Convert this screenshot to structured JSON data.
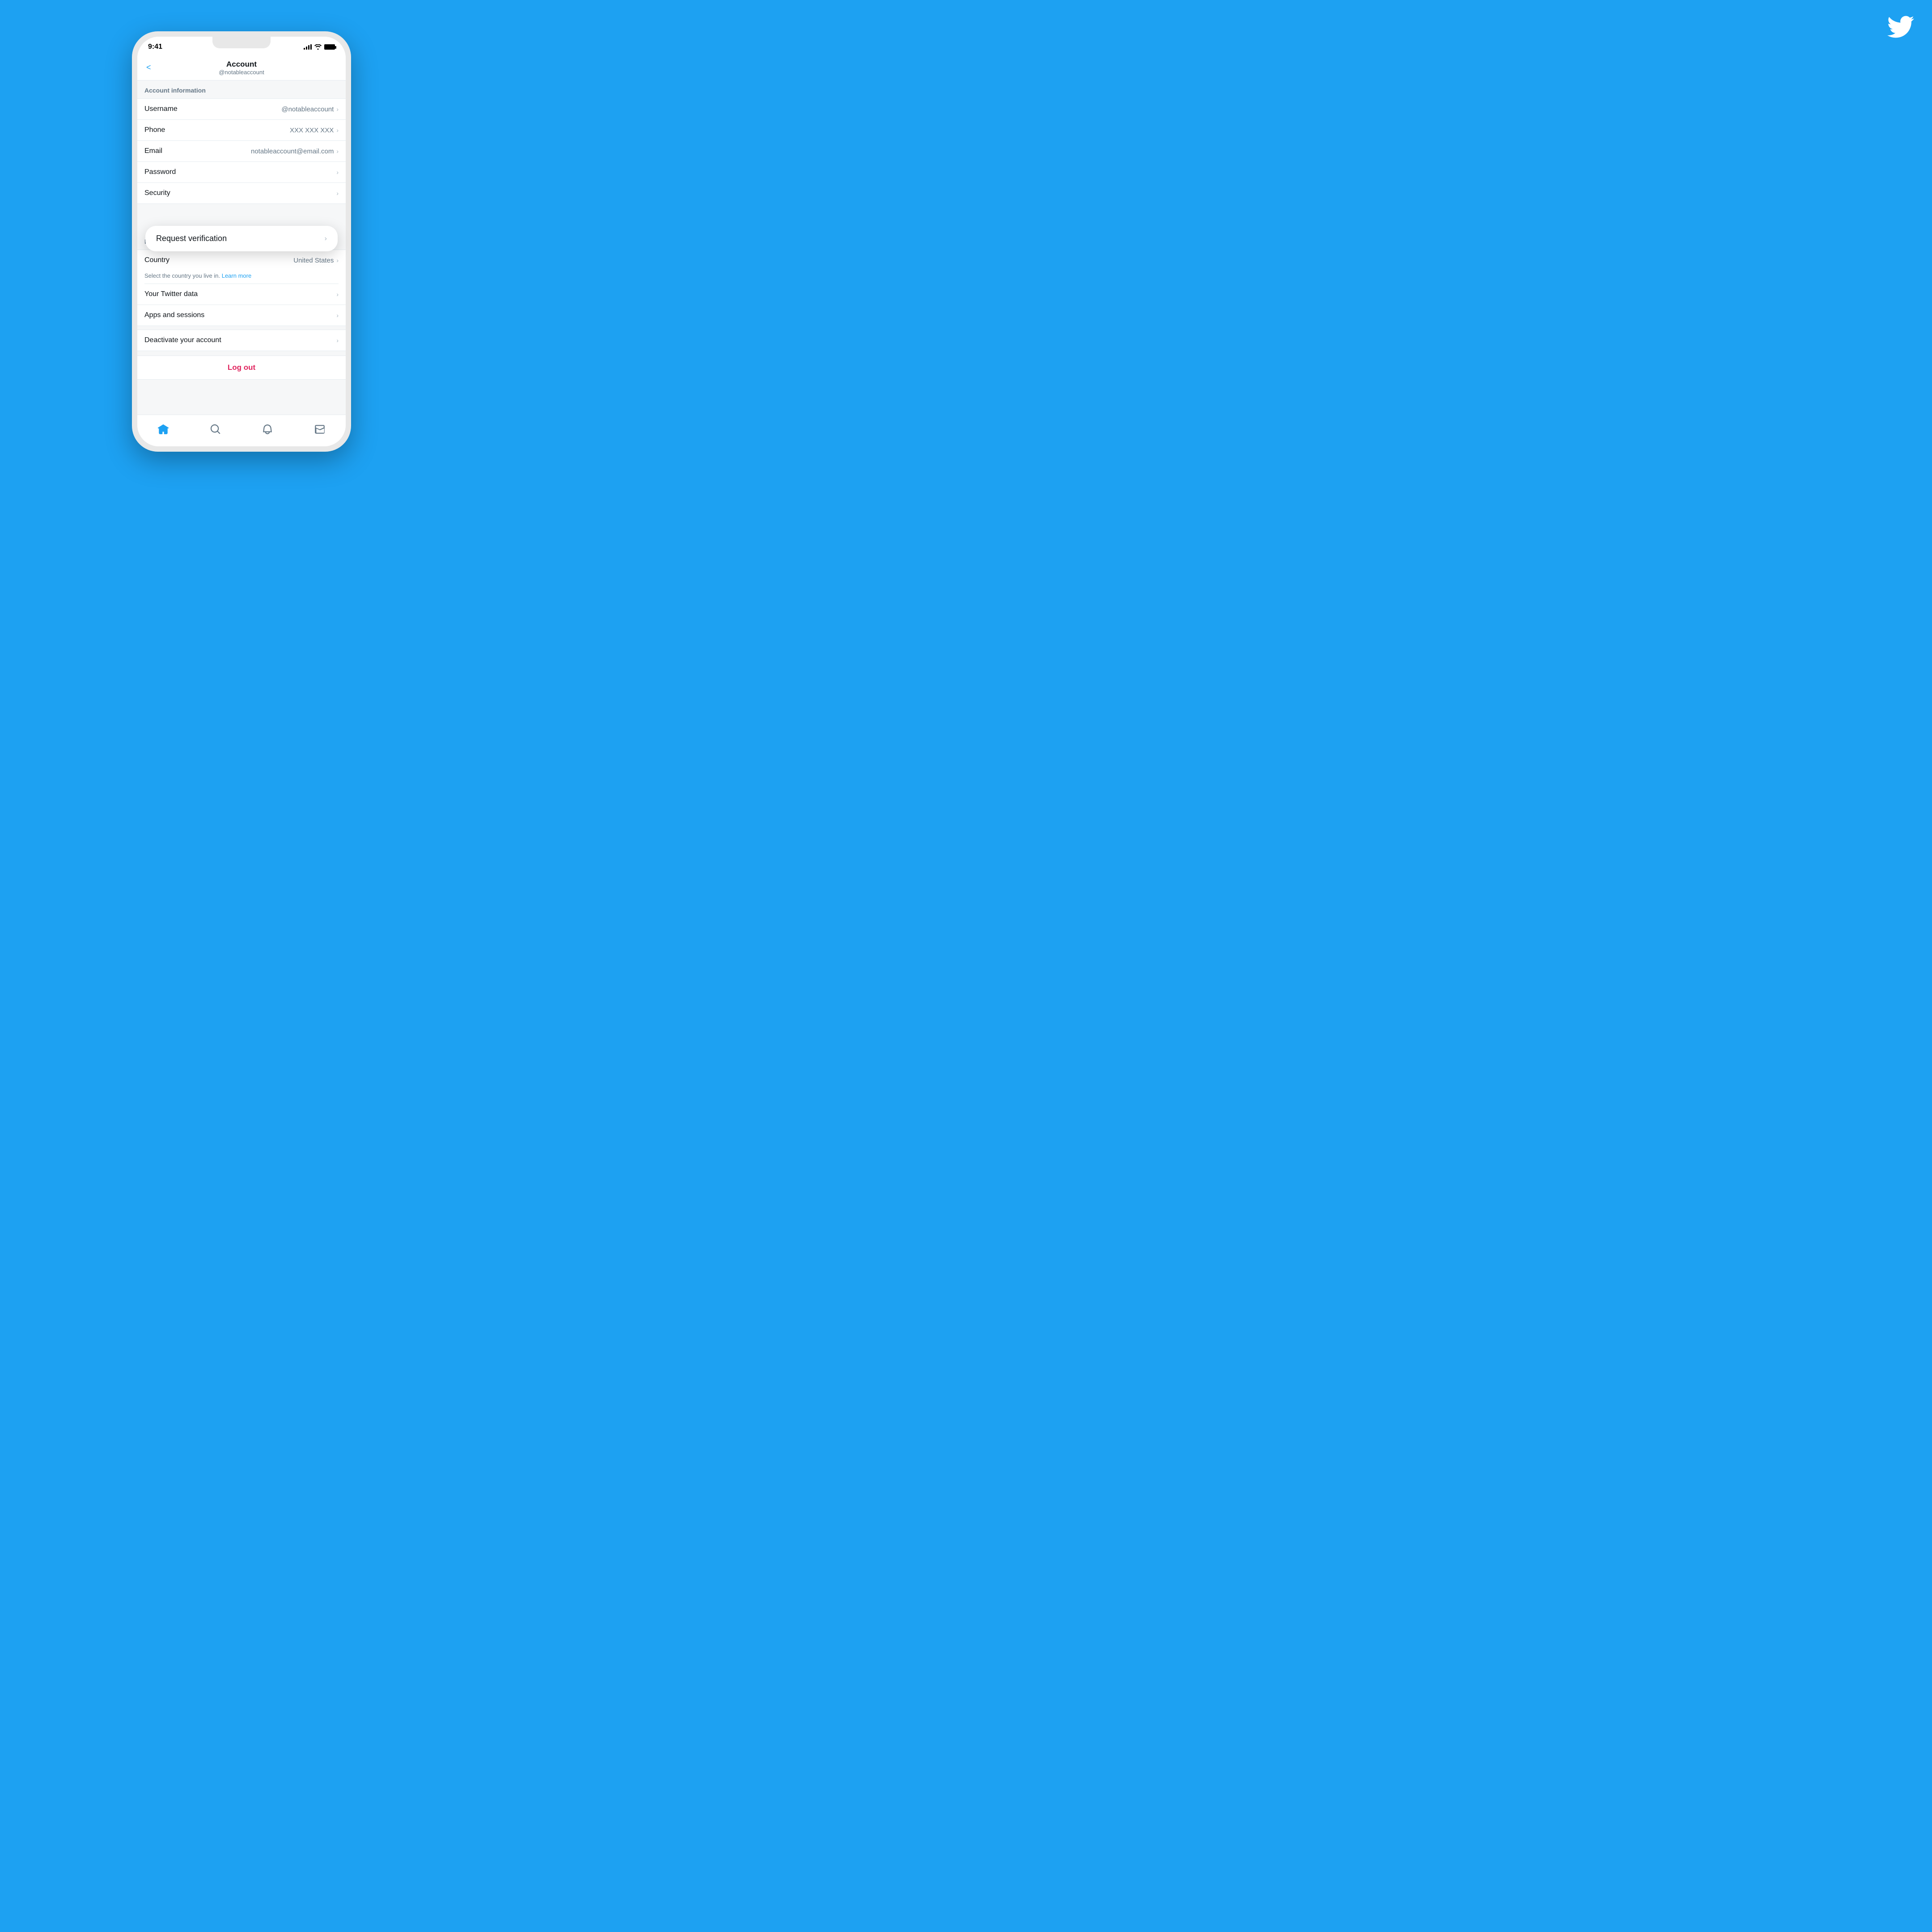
{
  "background_color": "#1DA1F2",
  "twitter_logo": "🐦",
  "status_bar": {
    "time": "9:41",
    "signal": "signal",
    "wifi": "wifi",
    "battery": "battery"
  },
  "nav": {
    "back_label": "<",
    "title": "Account",
    "subtitle": "@notableaccount"
  },
  "sections": {
    "account_info": {
      "title": "Account information",
      "items": [
        {
          "label": "Username",
          "value": "@notableaccount"
        },
        {
          "label": "Phone",
          "value": "XXX XXX XXX"
        },
        {
          "label": "Email",
          "value": "notableaccount@email.com"
        },
        {
          "label": "Password",
          "value": ""
        },
        {
          "label": "Security",
          "value": ""
        }
      ]
    },
    "request_verification": {
      "label": "Request verification"
    },
    "data_permissions": {
      "title": "Data and permissions",
      "items": [
        {
          "label": "Country",
          "value": "United States"
        },
        {
          "label": "Your Twitter data",
          "value": ""
        },
        {
          "label": "Apps and sessions",
          "value": ""
        }
      ]
    },
    "country_subtext": {
      "text": "Select the country you live in.",
      "link_label": "Learn more"
    },
    "deactivate": {
      "label": "Deactivate your account"
    },
    "logout": {
      "label": "Log out"
    }
  },
  "bottom_nav": {
    "home_label": "home",
    "search_label": "search",
    "notifications_label": "notifications",
    "messages_label": "messages"
  }
}
